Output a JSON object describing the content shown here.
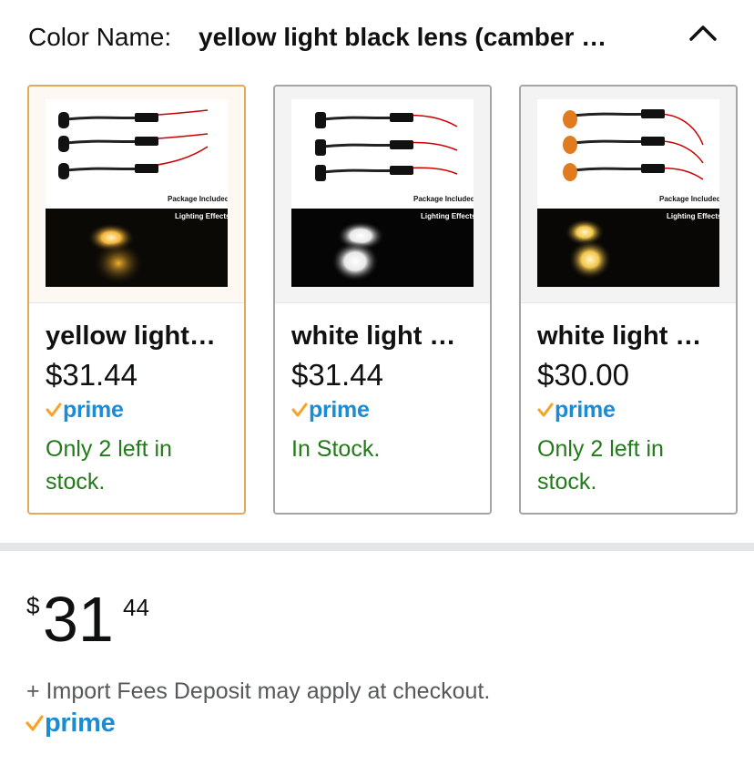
{
  "color_selector": {
    "label": "Color Name:",
    "selected_value": "yellow light black lens (camber …",
    "collapse_icon": "chevron-up-icon"
  },
  "swatches": [
    {
      "title": "yellow light…",
      "price": "$31.44",
      "prime": "prime",
      "stock": "Only 2 left in stock.",
      "image_text_top": "Package Included",
      "image_text_bottom": "Lighting Effects",
      "glow_color": "#f5b73a",
      "selected": true
    },
    {
      "title": "white light …",
      "price": "$31.44",
      "prime": "prime",
      "stock": "In Stock.",
      "image_text_top": "Package Included",
      "image_text_bottom": "Lighting Effects",
      "glow_color": "#ffffff",
      "selected": false
    },
    {
      "title": "white light …",
      "price": "$30.00",
      "prime": "prime",
      "stock": "Only 2 left in stock.",
      "image_text_top": "Package Included",
      "image_text_bottom": "Lighting Effects",
      "glow_color": "#f3c64a",
      "selected": false
    }
  ],
  "price": {
    "symbol": "$",
    "whole": "31",
    "fraction": "44"
  },
  "import_note": "+ Import Fees Deposit may apply at checkout.",
  "prime_badge": "prime",
  "colors": {
    "prime_blue": "#1b8bd3",
    "prime_check": "#f7a325",
    "in_stock_green": "#237a1b",
    "selected_border": "#e3a859"
  }
}
